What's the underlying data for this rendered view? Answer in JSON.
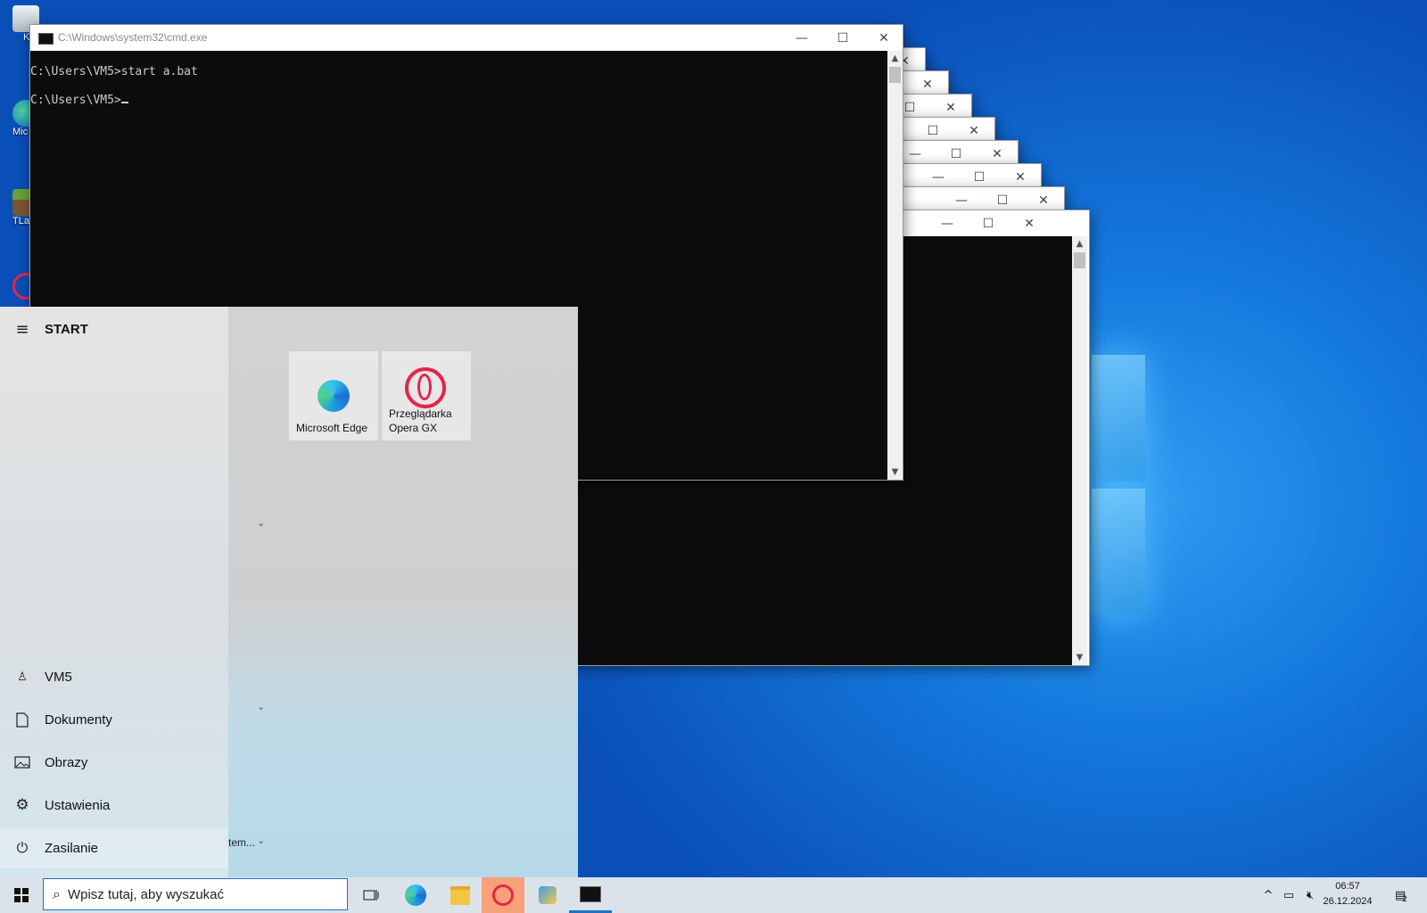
{
  "desktop": {
    "icons": [
      {
        "label": "K",
        "icon": "recycle-bin-icon"
      },
      {
        "label": "Mic E",
        "icon": "edge-shortcut-icon"
      },
      {
        "label": "TLau",
        "icon": "minecraft-shortcut-icon"
      },
      {
        "label": "",
        "icon": "opera-shortcut-icon"
      }
    ]
  },
  "cmd": {
    "title": "C:\\Windows\\system32\\cmd.exe",
    "line1": "C:\\Users\\VM5>start a.bat",
    "line2": "C:\\Users\\VM5>",
    "minimize_glyph": "—",
    "maximize_glyph": "☐",
    "close_glyph": "✕"
  },
  "start_menu": {
    "header": "START",
    "tiles": [
      {
        "label": "Microsoft Edge",
        "icon": "edge-icon"
      },
      {
        "label": "Przeglądarka Opera GX",
        "icon": "opera-gx-icon"
      }
    ],
    "group_fragment": "tem...",
    "nav": [
      {
        "label": "VM5",
        "icon": "user-icon"
      },
      {
        "label": "Dokumenty",
        "icon": "document-icon"
      },
      {
        "label": "Obrazy",
        "icon": "pictures-icon"
      },
      {
        "label": "Ustawienia",
        "icon": "settings-icon"
      },
      {
        "label": "Zasilanie",
        "icon": "power-icon"
      }
    ]
  },
  "taskbar": {
    "search_placeholder": "Wpisz tutaj, aby wyszukać",
    "apps": [
      "task-view-icon",
      "edge-icon",
      "file-explorer-icon",
      "opera-gx-icon",
      "app-icon",
      "cmd-icon"
    ],
    "time": "06:57",
    "date": "26.12.2024",
    "notification_count": "2"
  },
  "colors": {
    "desktop_blue": "#1478dc",
    "console_bg": "#0c0c0c",
    "console_fg": "#cccccc",
    "opera_red": "#e2264a"
  }
}
